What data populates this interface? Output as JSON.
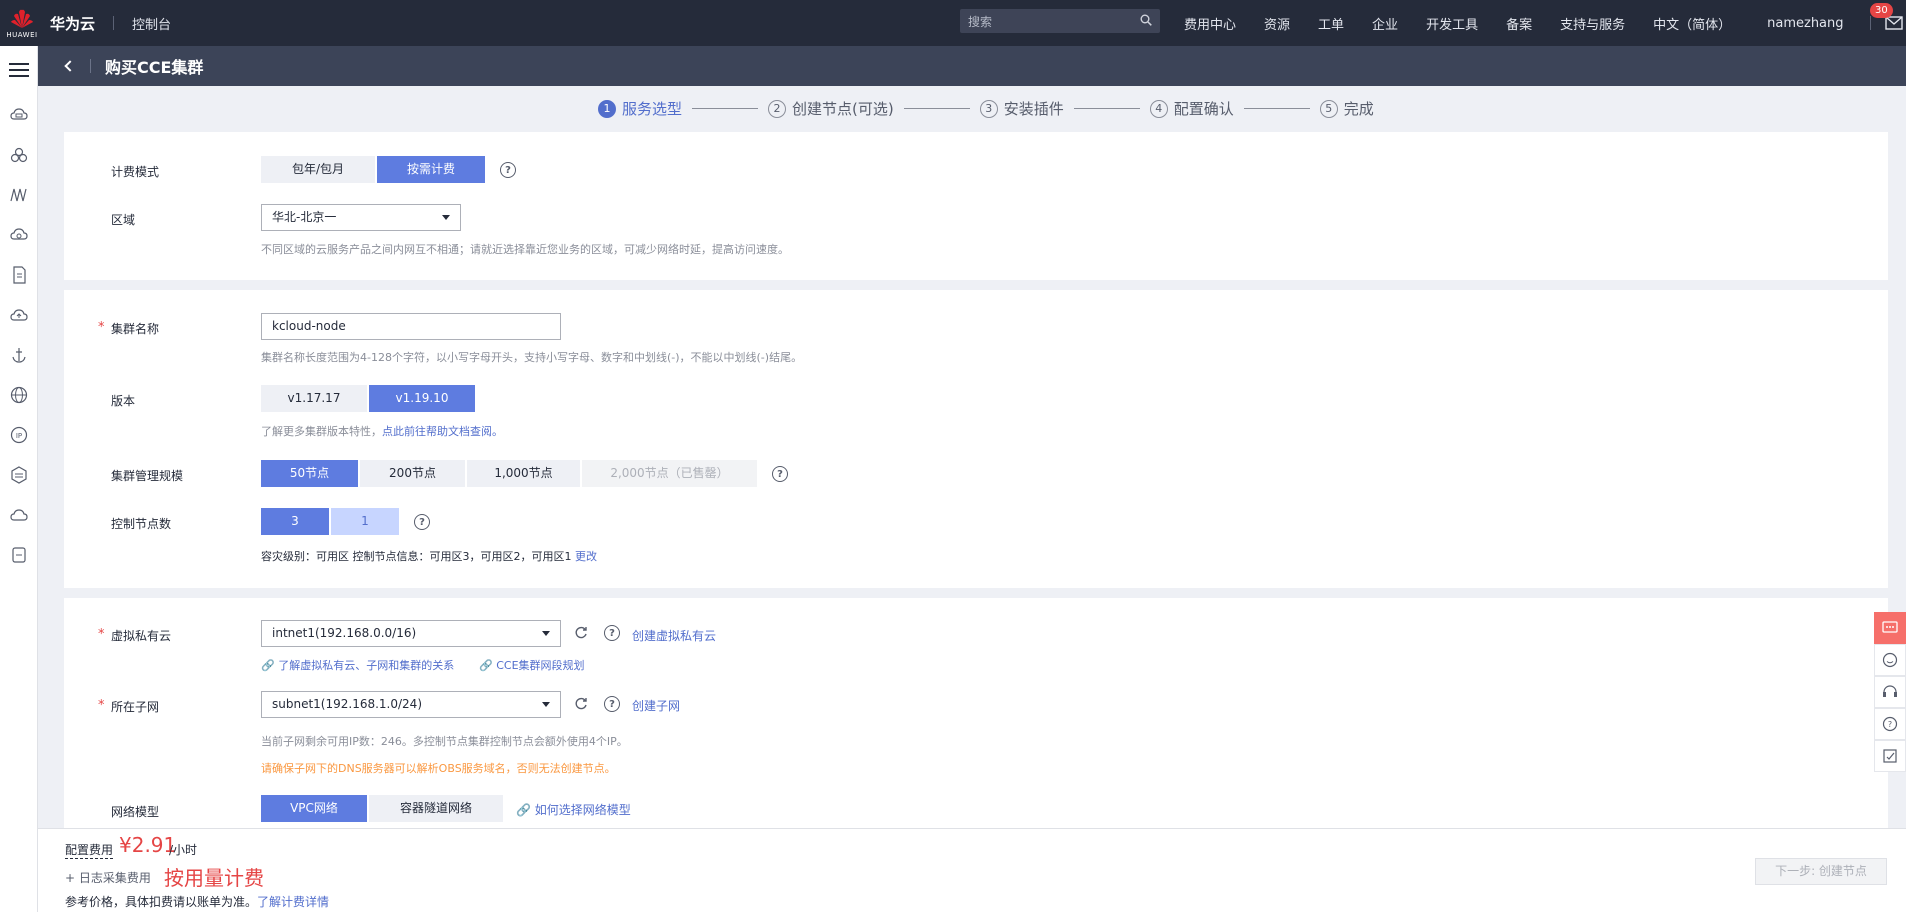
{
  "topbar": {
    "logo_caption": "HUAWEI",
    "brand": "华为云",
    "console": "控制台",
    "search_placeholder": "搜索",
    "nav": [
      "费用中心",
      "资源",
      "工单",
      "企业",
      "开发工具",
      "备案",
      "支持与服务"
    ],
    "language": "中文（简体）",
    "username": "namezhang",
    "mail_count": "30"
  },
  "page": {
    "title": "购买CCE集群"
  },
  "steps": [
    {
      "num": "1",
      "label": "服务选型"
    },
    {
      "num": "2",
      "label": "创建节点(可选)"
    },
    {
      "num": "3",
      "label": "安装插件"
    },
    {
      "num": "4",
      "label": "配置确认"
    },
    {
      "num": "5",
      "label": "完成"
    }
  ],
  "billing": {
    "label": "计费模式",
    "options": [
      "包年/包月",
      "按需计费"
    ],
    "selected": "按需计费"
  },
  "region": {
    "label": "区域",
    "value": "华北-北京一",
    "hint": "不同区域的云服务产品之间内网互不相通；请就近选择靠近您业务的区域，可减少网络时延，提高访问速度。"
  },
  "cluster_name": {
    "label": "集群名称",
    "value": "kcloud-node",
    "hint": "集群名称长度范围为4-128个字符，以小写字母开头，支持小写字母、数字和中划线(-)，不能以中划线(-)结尾。"
  },
  "version": {
    "label": "版本",
    "options": [
      "v1.17.17",
      "v1.19.10"
    ],
    "selected": "v1.19.10",
    "hint_prefix": "了解更多集群版本特性，",
    "hint_link": "点此前往帮助文档查阅。"
  },
  "scale": {
    "label": "集群管理规模",
    "options": [
      "50节点",
      "200节点",
      "1,000节点",
      "2,000节点（已售罄）"
    ],
    "selected": "50节点"
  },
  "masters": {
    "label": "控制节点数",
    "options": [
      "3",
      "1"
    ],
    "selected": "3",
    "info": "容灾级别：可用区    控制节点信息：可用区3，可用区2，可用区1",
    "change": "更改"
  },
  "vpc": {
    "label": "虚拟私有云",
    "value": "intnet1(192.168.0.0/16)",
    "create": "创建虚拟私有云",
    "link1": "了解虚拟私有云、子网和集群的关系",
    "link2": "CCE集群网段规划"
  },
  "subnet": {
    "label": "所在子网",
    "value": "subnet1(192.168.1.0/24)",
    "create": "创建子网",
    "hint": "当前子网剩余可用IP数：246。多控制节点集群控制节点会额外使用4个IP。",
    "warn": "请确保子网下的DNS服务器可以解析OBS服务域名，否则无法创建节点。"
  },
  "network_model": {
    "label": "网络模型",
    "options": [
      "VPC网络",
      "容器隧道网络"
    ],
    "selected": "VPC网络",
    "link": "如何选择网络模型"
  },
  "footer": {
    "fee_label": "配置费用",
    "price": "¥2.91",
    "unit": "/小时",
    "log_label": "日志采集费用",
    "log_price": "按用量计费",
    "ref_text": "参考价格，具体扣费请以账单为准。",
    "ref_link": "了解计费详情",
    "next": "下一步: 创建节点"
  },
  "colors": {
    "accent": "#5e7ce0",
    "topbar": "#252b3a",
    "price": "#e54545",
    "warn": "#fa9841"
  }
}
